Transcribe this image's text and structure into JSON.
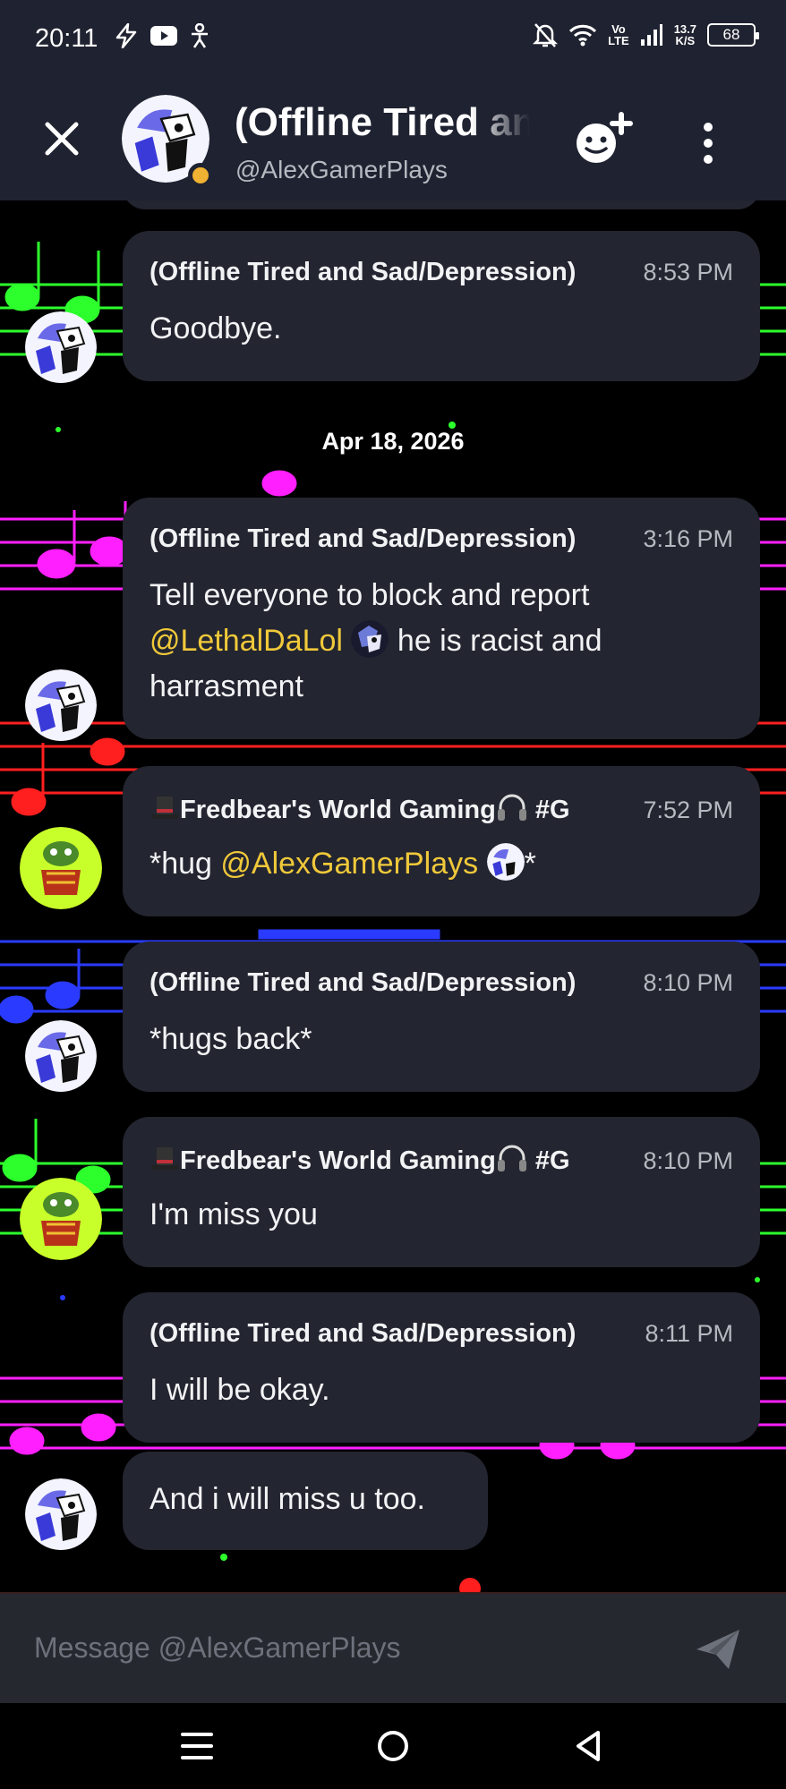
{
  "status_bar": {
    "time": "20:11",
    "network_top": "Vo",
    "network_bottom": "LTE",
    "speed_top": "13.7",
    "speed_bottom": "K/S",
    "battery": "68",
    "icons": [
      "bolt-icon",
      "youtube-icon",
      "accessibility-icon",
      "bell-off-icon",
      "wifi-icon",
      "signal-icon",
      "battery-icon"
    ]
  },
  "header": {
    "title": "(Offline Tired and Sad/Depression)",
    "username": "@AlexGamerPlays",
    "status_color": "#f0b232"
  },
  "date_separator": "Apr 18, 2026",
  "messages": [
    {
      "author": "(Offline Tired and Sad/Depression)",
      "time": "8:53 PM",
      "text": "Goodbye."
    },
    {
      "author": "(Offline Tired and Sad/Depression)",
      "time": "3:16 PM",
      "text_line1": "Tell everyone to block and report",
      "mention": "@LethalDaLol",
      "text_after": "he is racist and",
      "text_line3": "harrasment"
    },
    {
      "author": "Fredbear's World Gaming",
      "author_suffix": "#G",
      "time": "7:52 PM",
      "text_before": "*hug ",
      "mention": "@AlexGamerPlays",
      "text_after": "*"
    },
    {
      "author": "(Offline Tired and Sad/Depression)",
      "time": "8:10 PM",
      "text": "*hugs back*"
    },
    {
      "author": "Fredbear's World Gaming",
      "author_suffix": "#G",
      "time": "8:10 PM",
      "text": "I'm miss you"
    },
    {
      "author": "(Offline Tired and Sad/Depression)",
      "time": "8:11 PM",
      "text": "I will be okay."
    },
    {
      "text": "And i will miss u too."
    }
  ],
  "composer": {
    "placeholder": "Message @AlexGamerPlays"
  },
  "colors": {
    "accent_mention": "#f0c93a",
    "bubble": "#232530",
    "header": "#1f2230"
  }
}
